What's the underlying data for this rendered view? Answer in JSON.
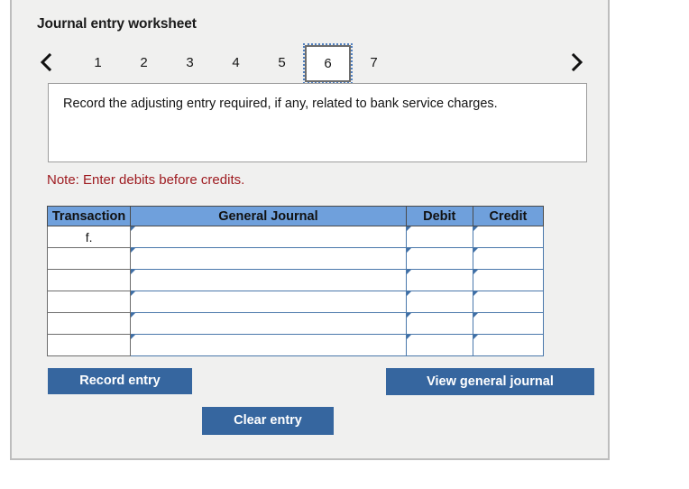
{
  "worksheet": {
    "title": "Journal entry worksheet",
    "nav": {
      "prev_label": "Previous entry",
      "next_label": "Next entry"
    },
    "tabs": [
      {
        "label": "1",
        "selected": false
      },
      {
        "label": "2",
        "selected": false
      },
      {
        "label": "3",
        "selected": false
      },
      {
        "label": "4",
        "selected": false
      },
      {
        "label": "5",
        "selected": false
      },
      {
        "label": "6",
        "selected": true
      },
      {
        "label": "7",
        "selected": false
      }
    ],
    "instruction": "Record the adjusting entry required, if any, related to bank service charges.",
    "note": "Note: Enter debits before credits."
  },
  "table": {
    "headers": {
      "transaction": "Transaction",
      "general_journal": "General Journal",
      "debit": "Debit",
      "credit": "Credit"
    },
    "rows": [
      {
        "transaction": "f.",
        "general_journal": "",
        "debit": "",
        "credit": ""
      },
      {
        "transaction": "",
        "general_journal": "",
        "debit": "",
        "credit": ""
      },
      {
        "transaction": "",
        "general_journal": "",
        "debit": "",
        "credit": ""
      },
      {
        "transaction": "",
        "general_journal": "",
        "debit": "",
        "credit": ""
      },
      {
        "transaction": "",
        "general_journal": "",
        "debit": "",
        "credit": ""
      },
      {
        "transaction": "",
        "general_journal": "",
        "debit": "",
        "credit": ""
      }
    ]
  },
  "buttons": {
    "record_entry": "Record entry",
    "clear_entry": "Clear entry",
    "view_general_journal": "View general journal"
  },
  "colors": {
    "header_blue": "#6fa0dc",
    "button_blue": "#36669f",
    "note_red": "#9e1b20",
    "panel_bg": "#f0f0ef",
    "input_border": "#4a78ab"
  }
}
